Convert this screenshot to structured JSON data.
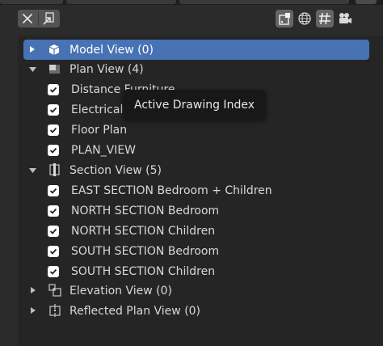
{
  "tooltip": {
    "text": "Active Drawing Index"
  },
  "tree": {
    "model_view": {
      "label": "Model View (0)",
      "expanded": false
    },
    "plan_view": {
      "label": "Plan View (4)",
      "expanded": true,
      "items": [
        {
          "label": "Distance Furniture",
          "checked": true
        },
        {
          "label": "Electrical",
          "checked": true
        },
        {
          "label": "Floor Plan",
          "checked": true
        },
        {
          "label": "PLAN_VIEW",
          "checked": true
        }
      ]
    },
    "section_view": {
      "label": "Section View (5)",
      "expanded": true,
      "items": [
        {
          "label": "EAST SECTION Bedroom + Children",
          "checked": true
        },
        {
          "label": "NORTH SECTION Bedroom",
          "checked": true
        },
        {
          "label": "NORTH SECTION Children",
          "checked": true
        },
        {
          "label": "SOUTH SECTION Bedroom",
          "checked": true
        },
        {
          "label": "SOUTH SECTION Children",
          "checked": true
        }
      ]
    },
    "elevation_view": {
      "label": "Elevation View (0)",
      "expanded": false
    },
    "reflected_plan_view": {
      "label": "Reflected Plan View (0)",
      "expanded": false
    }
  },
  "toolbar": {
    "left": [
      "close-icon",
      "export-icon"
    ],
    "right": [
      "drawing-sheet-icon",
      "globe-icon",
      "hatch-icon",
      "camera-icon"
    ]
  },
  "colors": {
    "selection": "#4772b3",
    "panel": "#2b2b2b",
    "list": "#252525",
    "text": "#d8d8d8"
  }
}
